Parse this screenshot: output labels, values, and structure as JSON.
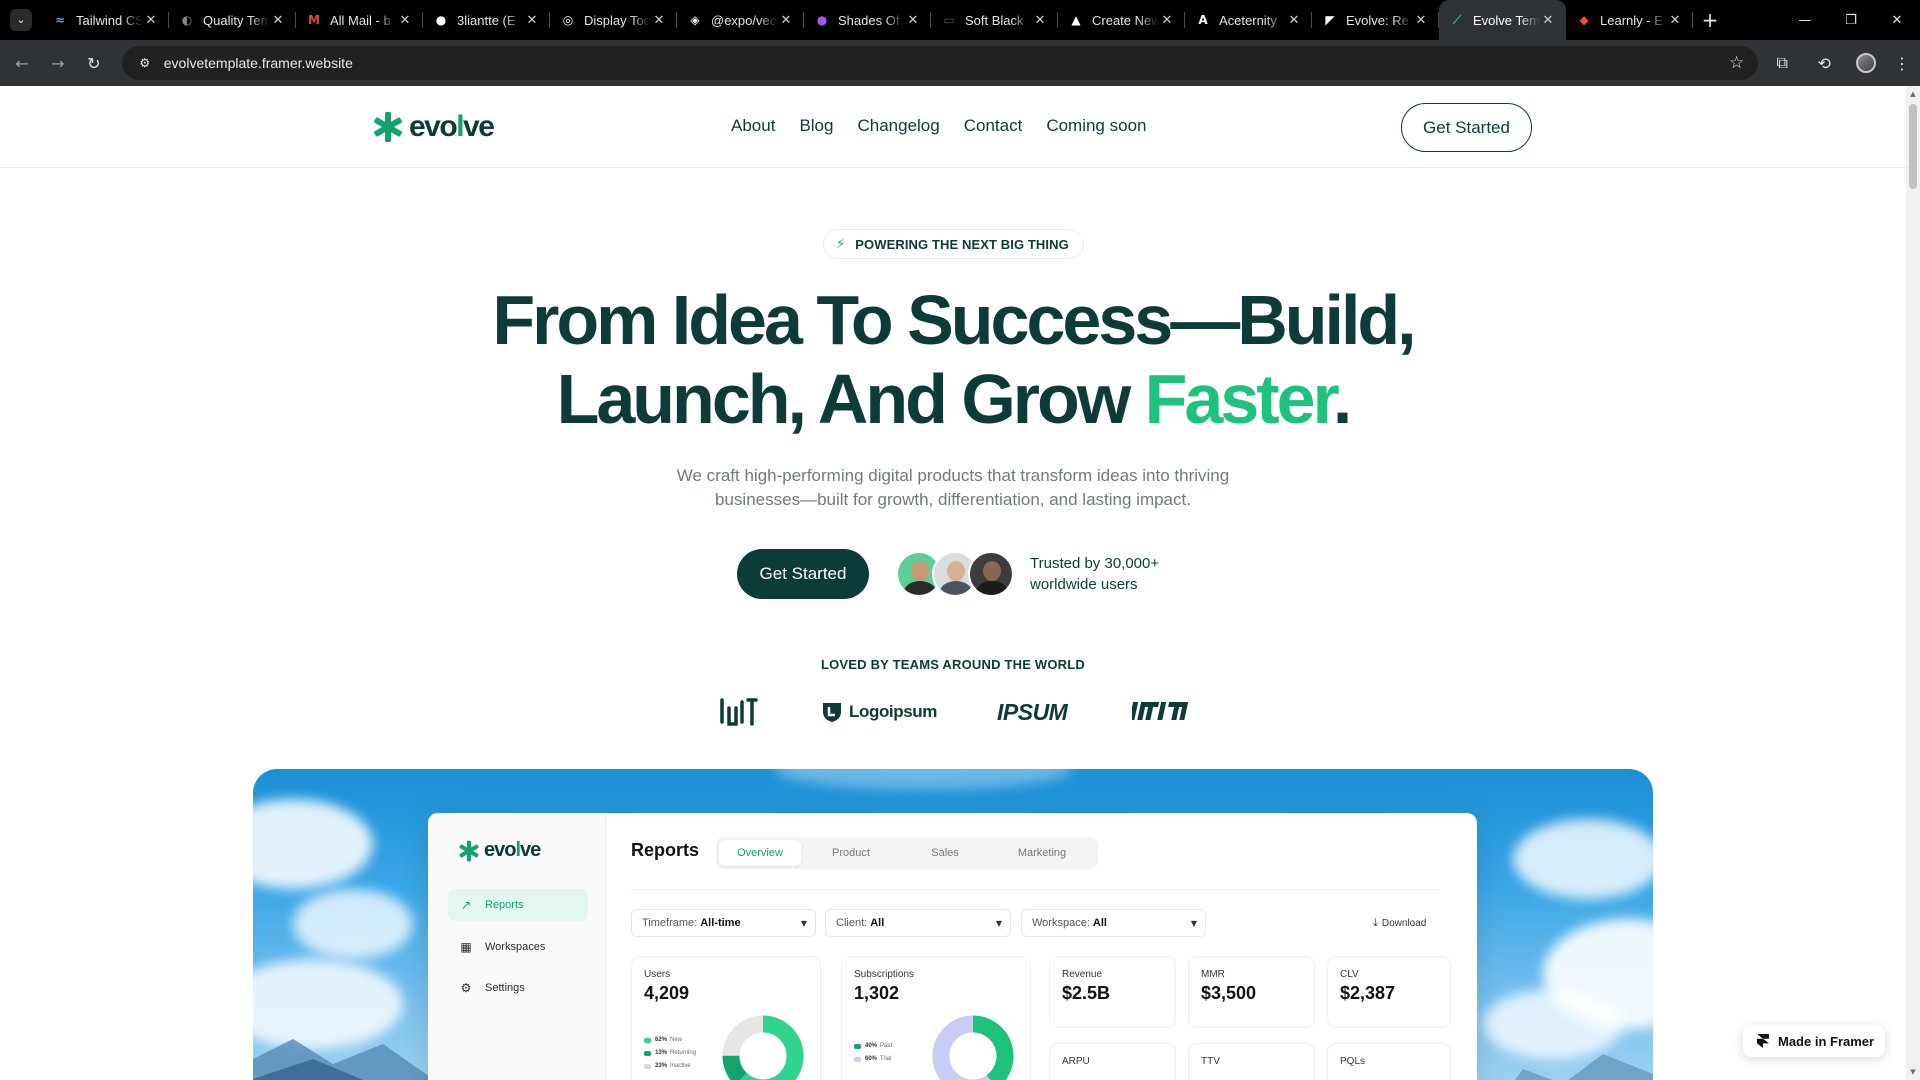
{
  "browser": {
    "tabs": [
      {
        "title": "Tailwind CSS",
        "icon": "tailwind-icon",
        "color": "#38bdf8"
      },
      {
        "title": "Quality Templates",
        "icon": "template-icon",
        "color": "#8a8a8a"
      },
      {
        "title": "All Mail - b",
        "icon": "gmail-icon",
        "color": "#ea4335"
      },
      {
        "title": "3liantte (E",
        "icon": "github-icon",
        "color": "#ffffff"
      },
      {
        "title": "Display Tool",
        "icon": "display-icon",
        "color": "#ffffff"
      },
      {
        "title": "@expo/vector",
        "icon": "expo-icon",
        "color": "#ffffff"
      },
      {
        "title": "Shades Of",
        "icon": "shades-icon",
        "color": "#a855f7"
      },
      {
        "title": "Soft Black",
        "icon": "soft-black-icon",
        "color": "#555555"
      },
      {
        "title": "Create New",
        "icon": "vercel-icon",
        "color": "#ffffff"
      },
      {
        "title": "Aceternity",
        "icon": "aceternity-icon",
        "color": "#ffffff"
      },
      {
        "title": "Evolve: Re",
        "icon": "framer-icon",
        "color": "#ffffff"
      },
      {
        "title": "Evolve Template",
        "icon": "evolve-icon",
        "color": "#1ec27d"
      },
      {
        "title": "Learnly - E",
        "icon": "learnly-icon",
        "color": "#f4511e"
      }
    ],
    "url": "evolvetemplate.framer.website"
  },
  "site": {
    "brand": "evolve",
    "nav": [
      "About",
      "Blog",
      "Changelog",
      "Contact",
      "Coming soon"
    ],
    "nav_cta": "Get Started",
    "badge": "POWERING THE NEXT BIG THING",
    "headline_line1": "From Idea To Success—Build,",
    "headline_line2_a": "Launch, And Grow ",
    "headline_line2_accent": "Faster",
    "headline_line2_end": ".",
    "subtext": "We craft high-performing digital products that transform ideas into thriving businesses—built for growth, differentiation, and lasting impact.",
    "cta": "Get Started",
    "trusted": "Trusted by 30,000+ worldwide users",
    "loved": "LOVED BY TEAMS AROUND THE WORLD",
    "partner_logos": [
      "logo-1",
      "Logoipsum",
      "IPSUM",
      "logo-4"
    ],
    "framer_badge": "Made in Framer"
  },
  "dashboard": {
    "brand": "evolve",
    "sidebar": [
      {
        "label": "Reports",
        "icon": "trend-icon",
        "active": true
      },
      {
        "label": "Workspaces",
        "icon": "grid-icon",
        "active": false
      },
      {
        "label": "Settings",
        "icon": "gear-icon",
        "active": false
      }
    ],
    "title": "Reports",
    "tabs": [
      {
        "label": "Overview",
        "active": true
      },
      {
        "label": "Product",
        "active": false
      },
      {
        "label": "Sales",
        "active": false
      },
      {
        "label": "Marketing",
        "active": false
      }
    ],
    "filters": [
      {
        "label": "Timeframe:",
        "value": "All-time"
      },
      {
        "label": "Client:",
        "value": "All"
      },
      {
        "label": "Workspace:",
        "value": "All"
      }
    ],
    "download": "Download",
    "users": {
      "label": "Users",
      "value": "4,209",
      "legend": [
        {
          "pct": "62%",
          "name": "New",
          "color": "#2fd38a"
        },
        {
          "pct": "13%",
          "name": "Returning",
          "color": "#14a36b"
        },
        {
          "pct": "23%",
          "name": "Inactive",
          "color": "#d9d9d9"
        }
      ]
    },
    "subscriptions": {
      "label": "Subscriptions",
      "value": "1,302",
      "legend": [
        {
          "pct": "40%",
          "name": "Paid",
          "color": "#14a36b"
        },
        {
          "pct": "60%",
          "name": "Trial",
          "color": "#c7cdf5"
        }
      ]
    },
    "metrics": [
      {
        "label": "Revenue",
        "value": "$2.5B"
      },
      {
        "label": "MMR",
        "value": "$3,500"
      },
      {
        "label": "CLV",
        "value": "$2,387"
      }
    ],
    "metrics_row2": [
      {
        "label": "ARPU"
      },
      {
        "label": "TTV"
      },
      {
        "label": "PQLs"
      }
    ]
  }
}
